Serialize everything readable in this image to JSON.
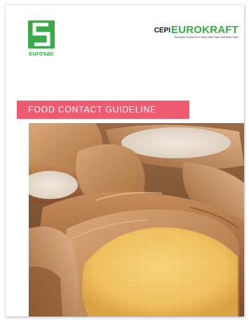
{
  "document": {
    "title": "FOOD CONTACT GUIDELINE"
  },
  "logos": {
    "eurosac": {
      "name": "eurosac",
      "icon": "eurosac-s-logo-icon",
      "color": "#3aa94a"
    },
    "cepi_eurokraft": {
      "prefix": "CEPI",
      "name": "EUROKRAFT",
      "tagline": "European Producers of Sack Kraft Paper and Kraft Paper",
      "color": "#3aa94a"
    }
  },
  "colors": {
    "banner": "#ee5a6f",
    "logo_green": "#3aa94a",
    "kraft_paper": "#c08552",
    "cornmeal": "#f0c060"
  },
  "cover_image": {
    "icon": "paper-sacks-of-flour-and-cornmeal-photo"
  }
}
